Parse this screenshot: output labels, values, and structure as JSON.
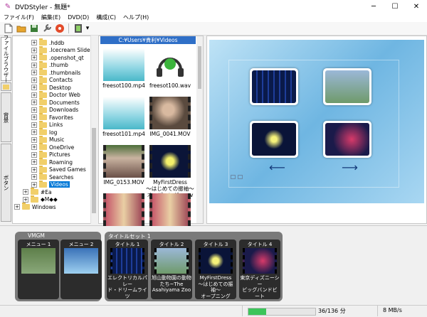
{
  "window": {
    "title": "DVDStyler - 無題*",
    "minimize": "─",
    "maximize": "☐",
    "close": "✕"
  },
  "menubar": [
    "ファイル(F)",
    "編集(E)",
    "DVD(D)",
    "構成(C)",
    "ヘルプ(H)"
  ],
  "side_tabs": [
    "ファイルブラウザー",
    "背景",
    "ボタン"
  ],
  "tree": {
    "items": [
      {
        "label": ".hddb",
        "expander": "+",
        "indent": 1
      },
      {
        "label": ".Icecream Slideshow",
        "expander": "+",
        "indent": 1
      },
      {
        "label": ".openshot_qt",
        "expander": "+",
        "indent": 1
      },
      {
        "label": ".thumb",
        "expander": "+",
        "indent": 1
      },
      {
        "label": ".thumbnails",
        "expander": "+",
        "indent": 1
      },
      {
        "label": "Contacts",
        "expander": "+",
        "indent": 1
      },
      {
        "label": "Desktop",
        "expander": "+",
        "indent": 1
      },
      {
        "label": "Doctor Web",
        "expander": "+",
        "indent": 1
      },
      {
        "label": "Documents",
        "expander": "+",
        "indent": 1
      },
      {
        "label": "Downloads",
        "expander": "+",
        "indent": 1
      },
      {
        "label": "Favorites",
        "expander": "+",
        "indent": 1
      },
      {
        "label": "Links",
        "expander": "+",
        "indent": 1
      },
      {
        "label": "log",
        "expander": "+",
        "indent": 1
      },
      {
        "label": "Music",
        "expander": "+",
        "indent": 1
      },
      {
        "label": "OneDrive",
        "expander": "+",
        "indent": 1
      },
      {
        "label": "Pictures",
        "expander": "+",
        "indent": 1
      },
      {
        "label": "Roaming",
        "expander": "+",
        "indent": 1
      },
      {
        "label": "Saved Games",
        "expander": "+",
        "indent": 1
      },
      {
        "label": "Searches",
        "expander": "+",
        "indent": 1
      },
      {
        "label": "Videos",
        "expander": "+",
        "indent": 1,
        "selected": true
      },
      {
        "label": "#Ea",
        "expander": "+",
        "indent": 0
      },
      {
        "label": "◆M◆◆",
        "expander": "+",
        "indent": 0
      },
      {
        "label": "Windows",
        "expander": "+",
        "indent": -1
      }
    ]
  },
  "file_panel": {
    "path": "C:¥Users¥貴利¥Videos",
    "files": [
      {
        "name": "freesot100.mp4",
        "thumb": "sky"
      },
      {
        "name": "freesot100.wav",
        "thumb": "headphones"
      },
      {
        "name": "freesot101.mp4",
        "thumb": "sky"
      },
      {
        "name": "IMG_0041.MOV",
        "thumb": "people"
      },
      {
        "name": "IMG_0153.MOV",
        "thumb": "garden"
      },
      {
        "name": "MyFirstDress\n〜はじめての振袖〜\nオープニング.wmv",
        "thumb": "butterfly"
      },
      {
        "name": "",
        "thumb": "kimono"
      },
      {
        "name": "",
        "thumb": "kimono"
      }
    ]
  },
  "preview": {
    "buttons": [
      "menu-thumb-1",
      "menu-thumb-2",
      "menu-thumb-3",
      "menu-thumb-4"
    ],
    "prev_arrow": "⟵",
    "next_arrow": "⟶"
  },
  "titlesets": {
    "vmgm_label": "VMGM",
    "titleset_label": "タイトルセット 1",
    "vmgm_cards": [
      {
        "label": "メニュー 1",
        "text": ""
      },
      {
        "label": "メニュー 2",
        "text": ""
      }
    ],
    "title_cards": [
      {
        "label": "タイトル 1",
        "text": "エレクトリカルパレー\nド・ドリームライツ\nElectrical Parade\nDreamlights TDL"
      },
      {
        "label": "タイトル 2",
        "text": "旭山動物園の動物\nたち~The\nAsahiyama Zoo"
      },
      {
        "label": "タイトル 3",
        "text": "MyFirstDress\n〜はじめての振袖〜\nオープニング"
      },
      {
        "label": "タイトル 4",
        "text": "東京ディズニーシー\nビッグバンドビート"
      }
    ]
  },
  "status": {
    "progress": 0.265,
    "duration": "36/136 分",
    "rate": "8 MB/s"
  },
  "colors": {
    "path_bar": "#2f6fc7",
    "progress": "#3cc55a",
    "group_bg": "#7a7a7a"
  }
}
